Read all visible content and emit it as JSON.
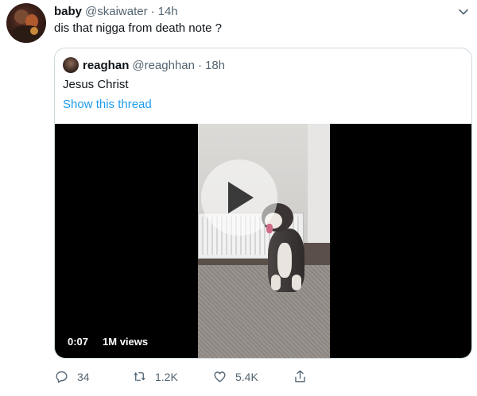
{
  "tweet": {
    "author": {
      "name": "baby",
      "handle": "@skaiwater",
      "separator": "·",
      "time": "14h"
    },
    "text": "dis that nigga from death note ?",
    "quoted": {
      "author": {
        "name": "reaghan",
        "handle": "@reaghhan",
        "separator": "·",
        "time": "18h"
      },
      "text": "Jesus Christ",
      "thread_link": "Show this thread",
      "video": {
        "duration": "0:07",
        "views": "1M views",
        "icon": "play-icon"
      }
    },
    "actions": {
      "reply": {
        "count": "34",
        "icon": "reply-icon"
      },
      "retweet": {
        "count": "1.2K",
        "icon": "retweet-icon"
      },
      "like": {
        "count": "5.4K",
        "icon": "heart-icon"
      },
      "share": {
        "icon": "share-icon"
      }
    },
    "menu_icon": "chevron-down-icon"
  },
  "colors": {
    "link": "#1d9bf0",
    "muted": "#536471",
    "text": "#0f1419",
    "border": "#cfd9de"
  }
}
